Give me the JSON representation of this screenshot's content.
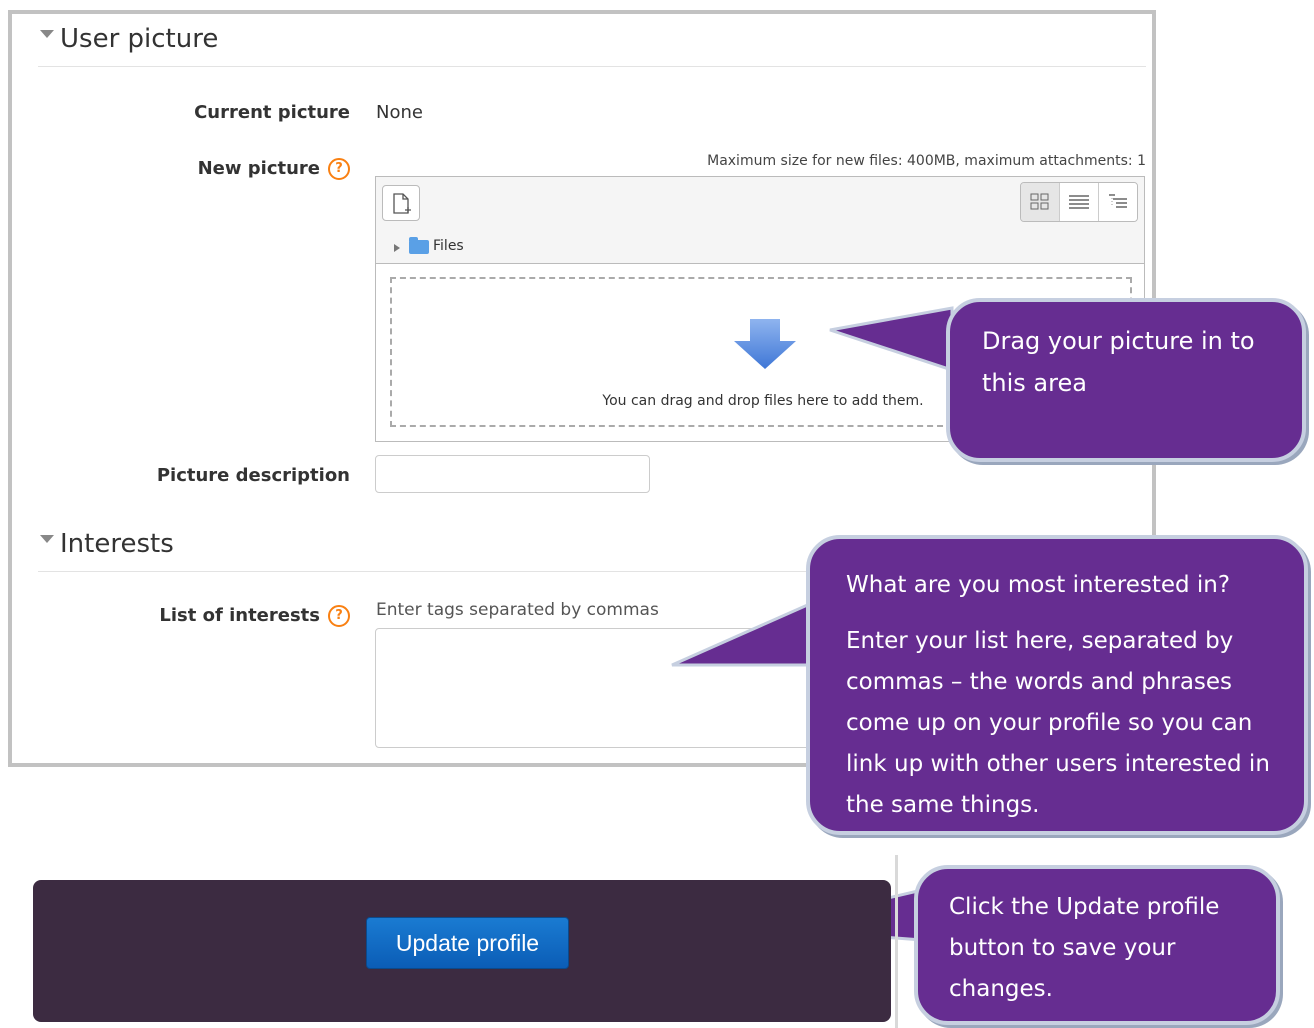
{
  "sections": {
    "user_picture": "User picture",
    "interests": "Interests"
  },
  "fields": {
    "current_picture_label": "Current picture",
    "current_picture_value": "None",
    "new_picture_label": "New picture",
    "max_size": "Maximum size for new files: 400MB, maximum attachments: 1",
    "files_path": "Files",
    "drop_text": "You can drag and drop files here to add them.",
    "picture_description_label": "Picture description",
    "picture_description_value": "",
    "interests_label": "List of interests",
    "interests_placeholder": "Enter tags separated by commas"
  },
  "help_glyph": "?",
  "callouts": {
    "drag": "Drag your picture in to this area",
    "interests_q": "What are  you most interested in?",
    "interests_body": "Enter your list here, separated by commas – the words and phrases come up on your profile so you can link up with other users interested in the same things.",
    "update": "Click the Update profile button to save your changes."
  },
  "button": {
    "update_profile": "Update profile"
  },
  "colors": {
    "callout": "#662d91",
    "panel": "#3c2b41",
    "help": "#f98012",
    "button": "#0b5db6"
  }
}
